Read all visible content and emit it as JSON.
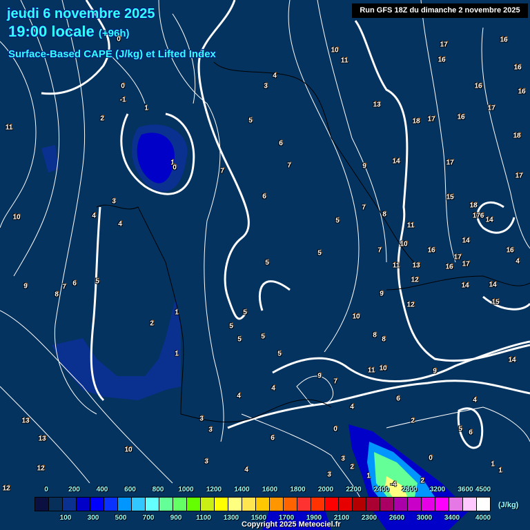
{
  "header": {
    "date": "jeudi 6 novembre 2025",
    "time": "19:00 locale",
    "lead": "(+96h)",
    "parameter": "Surface-Based CAPE (J/kg) et Lifted Index",
    "run": "Run GFS 18Z du dimanche 2 novembre 2025"
  },
  "lifted_index_labels": [
    "0",
    "-1",
    "0",
    "1",
    "2",
    "11",
    "1",
    "0",
    "10",
    "3",
    "4",
    "4",
    "9",
    "8",
    "7",
    "6",
    "5",
    "2",
    "1",
    "1",
    "4",
    "3",
    "5",
    "6",
    "7",
    "7",
    "6",
    "5",
    "5",
    "5",
    "5",
    "5",
    "5",
    "5",
    "5",
    "10",
    "11",
    "13",
    "14",
    "9",
    "17",
    "16",
    "16",
    "16",
    "16",
    "17",
    "16",
    "18",
    "17",
    "17",
    "16",
    "18",
    "17",
    "15",
    "18",
    "176",
    "14",
    "11",
    "10",
    "7",
    "8",
    "7",
    "16",
    "17",
    "17",
    "16",
    "14",
    "16",
    "4",
    "11",
    "13",
    "12",
    "14",
    "14",
    "15",
    "12",
    "9",
    "10",
    "8",
    "8",
    "11",
    "10",
    "9",
    "14",
    "9",
    "7",
    "4",
    "6",
    "4",
    "2",
    "4",
    "5",
    "6",
    "0",
    "0",
    "3",
    "2",
    "3",
    "1",
    "13",
    "13",
    "12",
    "12",
    "10",
    "4",
    "3",
    "3",
    "3",
    "4",
    "6",
    "1",
    "1",
    "-4",
    "2"
  ],
  "legend": {
    "colors": [
      "#0a1040",
      "#06305a",
      "#0a3090",
      "#0000c8",
      "#0000ff",
      "#0a32ff",
      "#0096ff",
      "#32c8ff",
      "#64ffff",
      "#64ff96",
      "#64ff64",
      "#64ff00",
      "#c8f014",
      "#ffff00",
      "#ffff80",
      "#ffe650",
      "#ffc800",
      "#ff9600",
      "#ff6400",
      "#ff3232",
      "#ff3200",
      "#ff0000",
      "#e60000",
      "#b40000",
      "#aa0032",
      "#aa0064",
      "#aa00aa",
      "#c800c8",
      "#e600e6",
      "#ff00ff",
      "#e678e6",
      "#ffc8ff",
      "#ffffff"
    ],
    "top_labels": [
      "0",
      "200",
      "400",
      "600",
      "800",
      "1000",
      "1200",
      "1400",
      "1600",
      "1800",
      "2000",
      "2200",
      "2400",
      "2800",
      "3200",
      "3600",
      "4500"
    ],
    "bottom_labels": [
      "100",
      "300",
      "500",
      "700",
      "900",
      "1100",
      "1300",
      "1500",
      "1700",
      "1900",
      "2100",
      "2300",
      "2600",
      "3000",
      "3400",
      "4000"
    ],
    "unit": "(J/kg)"
  },
  "copyright": "Copyright 2025 Meteociel.fr"
}
